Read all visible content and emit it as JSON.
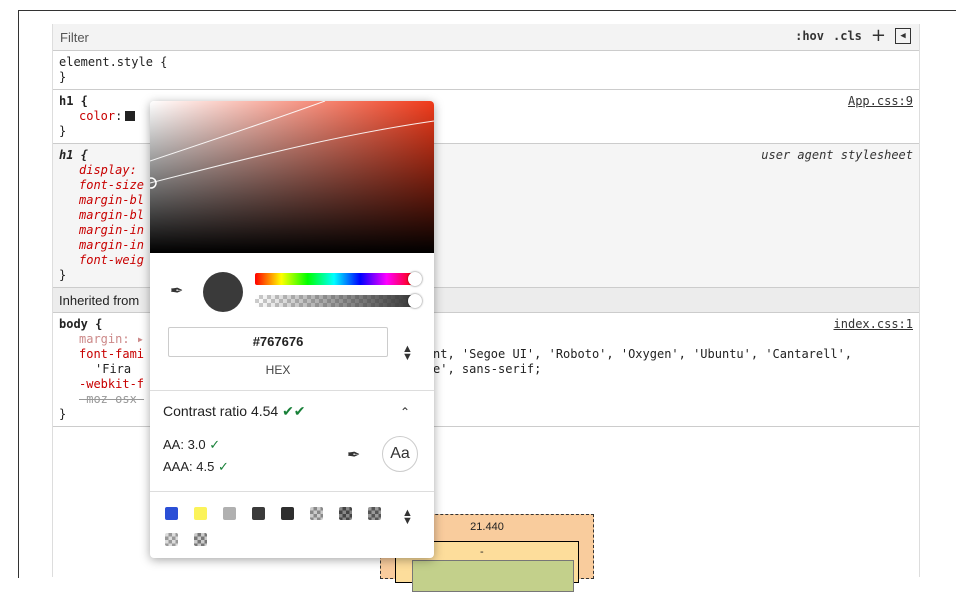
{
  "toolbar": {
    "filter_placeholder": "Filter",
    "hov": ":hov",
    "cls": ".cls",
    "plus": "+",
    "toggle_icon": "sidebar-toggle-icon"
  },
  "rules": {
    "element_style": {
      "selector": "element.style {",
      "close": "}"
    },
    "h1_app": {
      "selector": "h1 {",
      "prop": "color",
      "source": "App.css:9",
      "close": "}"
    },
    "h1_ua": {
      "selector": "h1 {",
      "source": "user agent stylesheet",
      "props": [
        "display:",
        "font-size",
        "margin-bl",
        "margin-bl",
        "margin-in",
        "margin-in",
        "font-weig"
      ],
      "close": "}"
    },
    "inherited": "Inherited from",
    "body": {
      "selector": "body {",
      "source": "index.css:1",
      "margin": "margin:",
      "font_family_prop": "font-fami",
      "font_family_value": "nt, 'Segoe UI', 'Roboto', 'Oxygen', 'Ubuntu', 'Cantarell',",
      "font_family_value2": "e', sans-serif;",
      "fira": "'Fira",
      "webkit": "-webkit-f",
      "moz": "-moz-osx-",
      "close": "}"
    }
  },
  "boxmodel": {
    "value": "21.440",
    "border_dash": "-"
  },
  "picker": {
    "hex_value": "#767676",
    "format_label": "HEX",
    "contrast_label": "Contrast ratio",
    "contrast_value": "4.54",
    "aa": "AA: 3.0",
    "aaa": "AAA: 4.5",
    "aa_button": "Aa",
    "swatch_color": "#3a3a3a",
    "palette_colors": [
      "#2b4fd6",
      "#fbf35a",
      "#b0b0b0",
      "#3a3a3a",
      "#2e2e2e",
      "#888888",
      "#444444",
      "#555555",
      "#999999",
      "#777777"
    ]
  }
}
